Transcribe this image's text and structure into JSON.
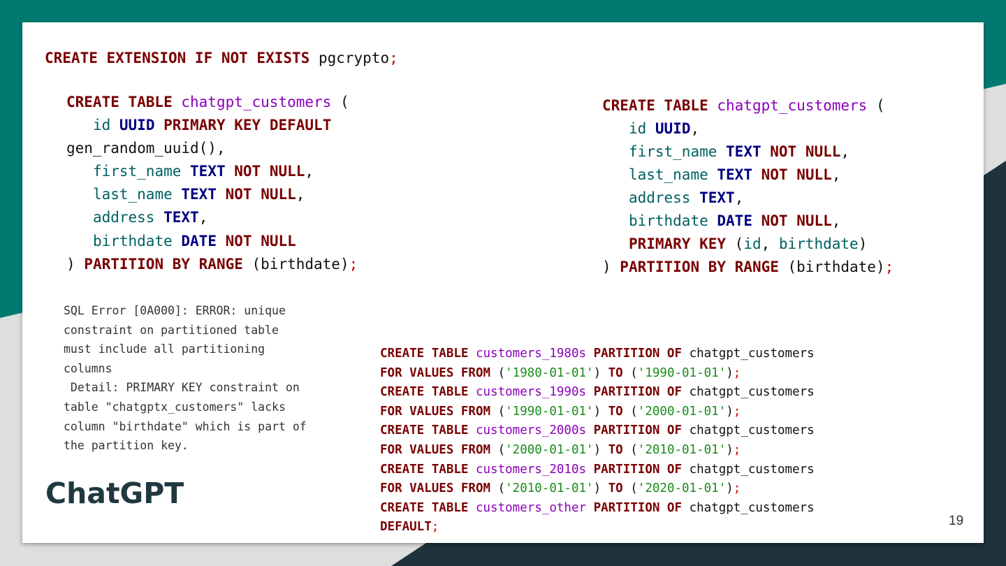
{
  "colors": {
    "teal": "#007a70",
    "dark_navy": "#1e333c",
    "background_grey": "#dedede",
    "keyword": "#7a0000",
    "type": "#000080",
    "table_name": "#8b00b8",
    "column": "#006060",
    "semicolon": "#d10000",
    "string": "#1a8c1a"
  },
  "code_ext": {
    "line": [
      {
        "kw": "CREATE EXTENSION IF NOT EXISTS",
        "name": " pgcrypto",
        "semi": ";"
      }
    ]
  },
  "code_left": {
    "l1": {
      "kw": "CREATE TABLE",
      "table": "chatgpt_customers",
      "open": " ("
    },
    "l2": {
      "indent": "   ",
      "col": "id",
      "type": "UUID",
      "kw": "PRIMARY KEY DEFAULT"
    },
    "l3": {
      "text": "gen_random_uuid(),"
    },
    "l4": {
      "indent": "   ",
      "col": "first_name",
      "type": "TEXT",
      "kw": "NOT NULL",
      "punct": ","
    },
    "l5": {
      "indent": "   ",
      "col": "last_name",
      "type": "TEXT",
      "kw": "NOT NULL",
      "punct": ","
    },
    "l6": {
      "indent": "   ",
      "col": "address",
      "type": "TEXT",
      "punct": ","
    },
    "l7": {
      "indent": "   ",
      "col": "birthdate",
      "type": "DATE",
      "kw": "NOT NULL"
    },
    "l8": {
      "close": ") ",
      "kw": "PARTITION BY RANGE",
      "arg": " (birthdate)",
      "semi": ";"
    }
  },
  "code_right": {
    "l1": {
      "kw": "CREATE TABLE",
      "table": "chatgpt_customers",
      "open": " ("
    },
    "l2": {
      "indent": "   ",
      "col": "id",
      "type": "UUID",
      "punct": ","
    },
    "l3": {
      "indent": "   ",
      "col": "first_name",
      "type": "TEXT",
      "kw": "NOT NULL",
      "punct": ","
    },
    "l4": {
      "indent": "   ",
      "col": "last_name",
      "type": "TEXT",
      "kw": "NOT NULL",
      "punct": ","
    },
    "l5": {
      "indent": "   ",
      "col": "address",
      "type": "TEXT",
      "punct": ","
    },
    "l6": {
      "indent": "   ",
      "col": "birthdate",
      "type": "DATE",
      "kw": "NOT NULL",
      "punct": ","
    },
    "l7": {
      "indent": "   ",
      "kw": "PRIMARY KEY",
      "open": " (",
      "col1": "id",
      "sep": ", ",
      "col2": "birthdate",
      "close": ")"
    },
    "l8": {
      "close": ") ",
      "kw": "PARTITION BY RANGE",
      "arg": " (birthdate)",
      "semi": ";"
    }
  },
  "partitions": {
    "create_kw": "CREATE TABLE",
    "partition_kw": "PARTITION OF",
    "parent": "chatgpt_customers",
    "for_values_kw": "FOR VALUES FROM",
    "to_kw": "TO",
    "items": [
      {
        "name": "customers_1980s",
        "from": "'1980-01-01'",
        "to": "'1990-01-01'"
      },
      {
        "name": "customers_1990s",
        "from": "'1990-01-01'",
        "to": "'2000-01-01'"
      },
      {
        "name": "customers_2000s",
        "from": "'2000-01-01'",
        "to": "'2010-01-01'"
      },
      {
        "name": "customers_2010s",
        "from": "'2010-01-01'",
        "to": "'2020-01-01'"
      }
    ],
    "default_item": {
      "name": "customers_other",
      "default_kw": "DEFAULT",
      "semi": ";"
    }
  },
  "error_message": "SQL Error [0A000]: ERROR: unique\nconstraint on partitioned table\nmust include all partitioning\ncolumns\n Detail: PRIMARY KEY constraint on\ntable \"chatgptx_customers\" lacks\ncolumn \"birthdate\" which is part of\nthe partition key.",
  "slide_title": "ChatGPT",
  "page_number": "19"
}
